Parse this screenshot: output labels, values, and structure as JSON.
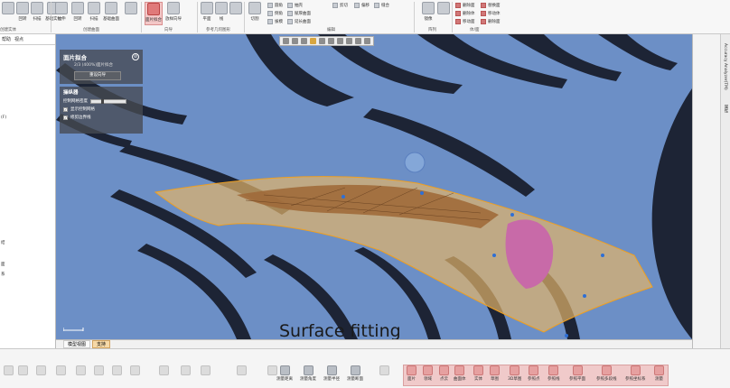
{
  "ribbon": {
    "groups": [
      {
        "label": "创建实体"
      },
      {
        "label": "创建曲面"
      },
      {
        "label": "向导"
      },
      {
        "label": "参考几何图形"
      },
      {
        "label": "编辑"
      },
      {
        "label": "阵列"
      },
      {
        "label": "体/面"
      }
    ],
    "buttons": [
      {
        "label": "拉伸"
      },
      {
        "label": "回转"
      },
      {
        "label": "扫描"
      },
      {
        "label": "基础实体"
      },
      {
        "label": "拉伸"
      },
      {
        "label": "回转"
      },
      {
        "label": "扫描"
      },
      {
        "label": "基础曲面"
      },
      {
        "label": "面片拟合"
      },
      {
        "label": "放样向导"
      },
      {
        "label": "平面"
      },
      {
        "label": "线"
      },
      {
        "label": "切割"
      }
    ],
    "edit_items": [
      {
        "label": "圆角"
      },
      {
        "label": "倒角"
      },
      {
        "label": "拔模"
      },
      {
        "label": "抽壳"
      },
      {
        "label": "赋厚曲面"
      },
      {
        "label": "延长曲面"
      },
      {
        "label": "剪切"
      },
      {
        "label": "偏移"
      },
      {
        "label": "缝合"
      }
    ],
    "array_items": [
      {
        "label": "镜像"
      }
    ],
    "body_items": [
      {
        "label": "删除面"
      },
      {
        "label": "删除体"
      },
      {
        "label": "移动面"
      },
      {
        "label": "替换面"
      },
      {
        "label": "移动体"
      },
      {
        "label": "删除面"
      }
    ]
  },
  "left_panel": {
    "tabs": [
      {
        "label": "帮助"
      },
      {
        "label": "视点"
      }
    ],
    "fragments": [
      "(F)",
      "结",
      "面",
      "系"
    ]
  },
  "dialog": {
    "title": "面片拟合",
    "subtitle": "2/3 (400%)面片拟合",
    "reset_label": "重设向导",
    "ops_title": "操纵器",
    "slider_label": "控制网格密度",
    "check1": "显示控制网格",
    "check2": "修剪边界线"
  },
  "viewport": {
    "caption": "Surface fitting",
    "colors": {
      "background": "#1d2435",
      "part": "#6c8fc6",
      "surface_orange": "#e2b36a",
      "mesh_brown": "#a06a3a",
      "pink": "#c86aa8"
    }
  },
  "right_panel": {
    "labels": [
      "Accuracy Analyzer(TM)",
      "属性"
    ]
  },
  "bottom_tabs": [
    {
      "label": "模型视图",
      "active": false
    },
    {
      "label": "支持",
      "active": true
    }
  ],
  "bottom_buttons": [
    {
      "label": "测量距离"
    },
    {
      "label": "测量角度"
    },
    {
      "label": "测量半径"
    },
    {
      "label": "测量断面"
    },
    {
      "label": "面片"
    },
    {
      "label": "领域"
    },
    {
      "label": "点云"
    },
    {
      "label": "曲面体"
    },
    {
      "label": "实体"
    },
    {
      "label": "草图"
    },
    {
      "label": "3D草图"
    },
    {
      "label": "参照点"
    },
    {
      "label": "参照线"
    },
    {
      "label": "参照平面"
    },
    {
      "label": "参照多段线"
    },
    {
      "label": "参照坐标系"
    },
    {
      "label": "测量"
    }
  ]
}
